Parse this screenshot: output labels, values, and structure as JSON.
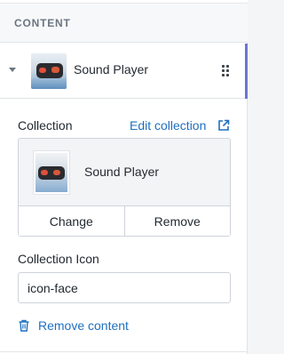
{
  "section": {
    "title": "CONTENT"
  },
  "content_item": {
    "label": "Sound Player",
    "thumbnail": "sound-player-image"
  },
  "collection": {
    "label": "Collection",
    "edit_link": "Edit collection",
    "selected_name": "Sound Player",
    "change_label": "Change",
    "remove_label": "Remove"
  },
  "collection_icon": {
    "label": "Collection Icon",
    "value": "icon-face"
  },
  "remove_content": {
    "label": "Remove content"
  },
  "colors": {
    "accent": "#6e74d6",
    "link": "#1f6fbf"
  },
  "icons": [
    "chevron-down-icon",
    "drag-handle-icon",
    "external-link-icon",
    "trash-icon"
  ]
}
